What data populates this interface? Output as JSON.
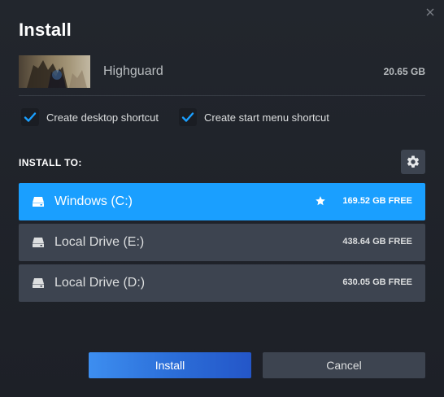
{
  "dialog": {
    "title": "Install"
  },
  "game": {
    "thumbnail_text": "HIGHGUARD",
    "name": "Highguard",
    "size": "20.65 GB"
  },
  "options": {
    "desktop_shortcut": {
      "label": "Create desktop shortcut",
      "checked": true
    },
    "start_menu_shortcut": {
      "label": "Create start menu shortcut",
      "checked": true
    }
  },
  "install_to": {
    "heading": "INSTALL TO:",
    "drives": [
      {
        "name": "Windows (C:)",
        "free": "169.52 GB FREE",
        "selected": true,
        "default_icon": "star-icon"
      },
      {
        "name": "Local Drive (E:)",
        "free": "438.64 GB FREE",
        "selected": false
      },
      {
        "name": "Local Drive (D:)",
        "free": "630.05 GB FREE",
        "selected": false
      }
    ]
  },
  "buttons": {
    "install": "Install",
    "cancel": "Cancel"
  },
  "colors": {
    "background": "#23272f",
    "accent": "#1a9fff",
    "panel": "#3d4450",
    "check": "#1a9fff"
  }
}
